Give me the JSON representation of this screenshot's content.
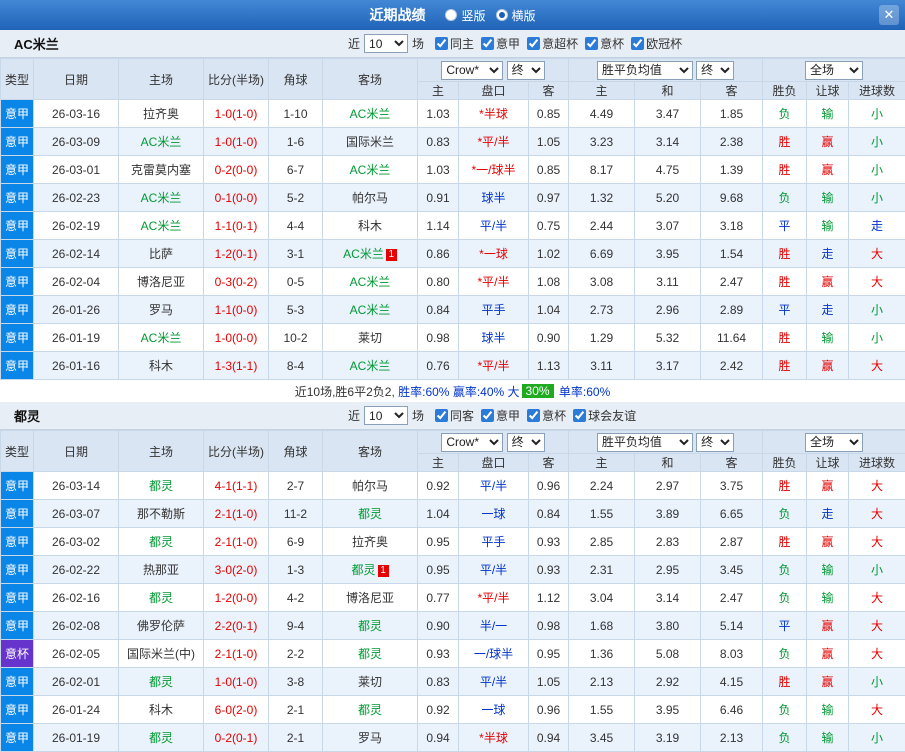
{
  "colors": {
    "topbar_from": "#4288d5",
    "topbar_to": "#2063b8",
    "type_league": "#0a85e8",
    "type_cup": "#6633cc",
    "focus_team": "#009933",
    "score_red": "#e60000",
    "hc_star": "#e60000",
    "hc_normal": "#0033cc",
    "res_red": "#e60000",
    "res_green": "#009933",
    "res_blue": "#0033cc",
    "row_alt": "#eaf2fb",
    "header_bg": "#dae5f3",
    "section_bg": "#e8eef6",
    "badge_green": "#1faa1f"
  },
  "topbar": {
    "title": "近期战绩",
    "radio_vertical": "竖版",
    "radio_horizontal": "横版",
    "selected_layout": "横版",
    "close": "✕"
  },
  "table_header": {
    "type": "类型",
    "date": "日期",
    "home": "主场",
    "score": "比分(半场)",
    "corner": "角球",
    "away": "客场",
    "crow": "Crow*",
    "final1": "终",
    "odds_home": "主",
    "handicap": "盘口",
    "odds_away": "客",
    "avg": "胜平负均值",
    "final2": "终",
    "win": "主",
    "draw": "和",
    "lose": "客",
    "fulltime": "全场",
    "result": "胜负",
    "let": "让球",
    "goals": "进球数"
  },
  "sections": [
    {
      "team": "AC米兰",
      "near_label": "近",
      "count": "10",
      "games_label": "场",
      "checkboxes": [
        "同主",
        "意甲",
        "意超杯",
        "意杯",
        "欧冠杯"
      ],
      "rows": [
        {
          "type": "意甲",
          "date": "26-03-16",
          "home": "拉齐奥",
          "score": "1-0(1-0)",
          "corner": "1-10",
          "away": "AC米兰",
          "odds_home": "1.03",
          "handicap": "*半球",
          "odds_away": "0.85",
          "win": "4.49",
          "draw": "3.47",
          "lose": "1.85",
          "result": "负",
          "let": "输",
          "goals": "小"
        },
        {
          "type": "意甲",
          "date": "26-03-09",
          "home": "AC米兰",
          "score": "1-0(1-0)",
          "corner": "1-6",
          "away": "国际米兰",
          "odds_home": "0.83",
          "handicap": "*平/半",
          "odds_away": "1.05",
          "win": "3.23",
          "draw": "3.14",
          "lose": "2.38",
          "result": "胜",
          "let": "赢",
          "goals": "小"
        },
        {
          "type": "意甲",
          "date": "26-03-01",
          "home": "克雷莫内塞",
          "score": "0-2(0-0)",
          "corner": "6-7",
          "away": "AC米兰",
          "odds_home": "1.03",
          "handicap": "*一/球半",
          "odds_away": "0.85",
          "win": "8.17",
          "draw": "4.75",
          "lose": "1.39",
          "result": "胜",
          "let": "赢",
          "goals": "小"
        },
        {
          "type": "意甲",
          "date": "26-02-23",
          "home": "AC米兰",
          "score": "0-1(0-0)",
          "corner": "5-2",
          "away": "帕尔马",
          "odds_home": "0.91",
          "handicap": "球半",
          "odds_away": "0.97",
          "win": "1.32",
          "draw": "5.20",
          "lose": "9.68",
          "result": "负",
          "let": "输",
          "goals": "小"
        },
        {
          "type": "意甲",
          "date": "26-02-19",
          "home": "AC米兰",
          "score": "1-1(0-1)",
          "corner": "4-4",
          "away": "科木",
          "odds_home": "1.14",
          "handicap": "平/半",
          "odds_away": "0.75",
          "win": "2.44",
          "draw": "3.07",
          "lose": "3.18",
          "result": "平",
          "let": "输",
          "goals": "走"
        },
        {
          "type": "意甲",
          "date": "26-02-14",
          "home": "比萨",
          "score": "1-2(0-1)",
          "corner": "3-1",
          "away": "AC米兰",
          "away_card": "1",
          "odds_home": "0.86",
          "handicap": "*一球",
          "odds_away": "1.02",
          "win": "6.69",
          "draw": "3.95",
          "lose": "1.54",
          "result": "胜",
          "let": "走",
          "goals": "大"
        },
        {
          "type": "意甲",
          "date": "26-02-04",
          "home": "博洛尼亚",
          "score": "0-3(0-2)",
          "corner": "0-5",
          "away": "AC米兰",
          "odds_home": "0.80",
          "handicap": "*平/半",
          "odds_away": "1.08",
          "win": "3.08",
          "draw": "3.11",
          "lose": "2.47",
          "result": "胜",
          "let": "赢",
          "goals": "大"
        },
        {
          "type": "意甲",
          "date": "26-01-26",
          "home": "罗马",
          "score": "1-1(0-0)",
          "corner": "5-3",
          "away": "AC米兰",
          "odds_home": "0.84",
          "handicap": "平手",
          "odds_away": "1.04",
          "win": "2.73",
          "draw": "2.96",
          "lose": "2.89",
          "result": "平",
          "let": "走",
          "goals": "小"
        },
        {
          "type": "意甲",
          "date": "26-01-19",
          "home": "AC米兰",
          "score": "1-0(0-0)",
          "corner": "10-2",
          "away": "莱切",
          "odds_home": "0.98",
          "handicap": "球半",
          "odds_away": "0.90",
          "win": "1.29",
          "draw": "5.32",
          "lose": "11.64",
          "result": "胜",
          "let": "输",
          "goals": "小"
        },
        {
          "type": "意甲",
          "date": "26-01-16",
          "home": "科木",
          "score": "1-3(1-1)",
          "corner": "8-4",
          "away": "AC米兰",
          "odds_home": "0.76",
          "handicap": "*平/半",
          "odds_away": "1.13",
          "win": "3.11",
          "draw": "3.17",
          "lose": "2.42",
          "result": "胜",
          "let": "赢",
          "goals": "大"
        }
      ],
      "summary": [
        {
          "text": "近10场,胜6平2负2, ",
          "style": "dark"
        },
        {
          "text": "胜率:60% ",
          "style": "blue"
        },
        {
          "text": "赢率:40% ",
          "style": "blue"
        },
        {
          "text": "大",
          "style": "blue"
        },
        {
          "text": "30%",
          "style": "badge"
        },
        {
          "text": " 单率:60%",
          "style": "blue"
        }
      ]
    },
    {
      "team": "都灵",
      "near_label": "近",
      "count": "10",
      "games_label": "场",
      "checkboxes": [
        "同客",
        "意甲",
        "意杯",
        "球会友谊"
      ],
      "rows": [
        {
          "type": "意甲",
          "date": "26-03-14",
          "home": "都灵",
          "score": "4-1(1-1)",
          "corner": "2-7",
          "away": "帕尔马",
          "odds_home": "0.92",
          "handicap": "平/半",
          "odds_away": "0.96",
          "win": "2.24",
          "draw": "2.97",
          "lose": "3.75",
          "result": "胜",
          "let": "赢",
          "goals": "大"
        },
        {
          "type": "意甲",
          "date": "26-03-07",
          "home": "那不勒斯",
          "score": "2-1(1-0)",
          "corner": "11-2",
          "away": "都灵",
          "odds_home": "1.04",
          "handicap": "一球",
          "odds_away": "0.84",
          "win": "1.55",
          "draw": "3.89",
          "lose": "6.65",
          "result": "负",
          "let": "走",
          "goals": "大"
        },
        {
          "type": "意甲",
          "date": "26-03-02",
          "home": "都灵",
          "score": "2-1(1-0)",
          "corner": "6-9",
          "away": "拉齐奥",
          "odds_home": "0.95",
          "handicap": "平手",
          "odds_away": "0.93",
          "win": "2.85",
          "draw": "2.83",
          "lose": "2.87",
          "result": "胜",
          "let": "赢",
          "goals": "大"
        },
        {
          "type": "意甲",
          "date": "26-02-22",
          "home": "热那亚",
          "score": "3-0(2-0)",
          "corner": "1-3",
          "away": "都灵",
          "away_card": "1",
          "odds_home": "0.95",
          "handicap": "平/半",
          "odds_away": "0.93",
          "win": "2.31",
          "draw": "2.95",
          "lose": "3.45",
          "result": "负",
          "let": "输",
          "goals": "小"
        },
        {
          "type": "意甲",
          "date": "26-02-16",
          "home": "都灵",
          "score": "1-2(0-0)",
          "corner": "4-2",
          "away": "博洛尼亚",
          "odds_home": "0.77",
          "handicap": "*平/半",
          "odds_away": "1.12",
          "win": "3.04",
          "draw": "3.14",
          "lose": "2.47",
          "result": "负",
          "let": "输",
          "goals": "大"
        },
        {
          "type": "意甲",
          "date": "26-02-08",
          "home": "佛罗伦萨",
          "score": "2-2(0-1)",
          "corner": "9-4",
          "away": "都灵",
          "odds_home": "0.90",
          "handicap": "半/一",
          "odds_away": "0.98",
          "win": "1.68",
          "draw": "3.80",
          "lose": "5.14",
          "result": "平",
          "let": "赢",
          "goals": "大"
        },
        {
          "type": "意杯",
          "date": "26-02-05",
          "home": "国际米兰(中)",
          "score": "2-1(1-0)",
          "corner": "2-2",
          "away": "都灵",
          "odds_home": "0.93",
          "handicap": "一/球半",
          "odds_away": "0.95",
          "win": "1.36",
          "draw": "5.08",
          "lose": "8.03",
          "result": "负",
          "let": "赢",
          "goals": "大"
        },
        {
          "type": "意甲",
          "date": "26-02-01",
          "home": "都灵",
          "score": "1-0(1-0)",
          "corner": "3-8",
          "away": "莱切",
          "odds_home": "0.83",
          "handicap": "平/半",
          "odds_away": "1.05",
          "win": "2.13",
          "draw": "2.92",
          "lose": "4.15",
          "result": "胜",
          "let": "赢",
          "goals": "小"
        },
        {
          "type": "意甲",
          "date": "26-01-24",
          "home": "科木",
          "score": "6-0(2-0)",
          "corner": "2-1",
          "away": "都灵",
          "odds_home": "0.92",
          "handicap": "一球",
          "odds_away": "0.96",
          "win": "1.55",
          "draw": "3.95",
          "lose": "6.46",
          "result": "负",
          "let": "输",
          "goals": "大"
        },
        {
          "type": "意甲",
          "date": "26-01-19",
          "home": "都灵",
          "score": "0-2(0-1)",
          "corner": "2-1",
          "away": "罗马",
          "odds_home": "0.94",
          "handicap": "*半球",
          "odds_away": "0.94",
          "win": "3.45",
          "draw": "3.19",
          "lose": "2.13",
          "result": "负",
          "let": "输",
          "goals": "小"
        }
      ]
    }
  ]
}
